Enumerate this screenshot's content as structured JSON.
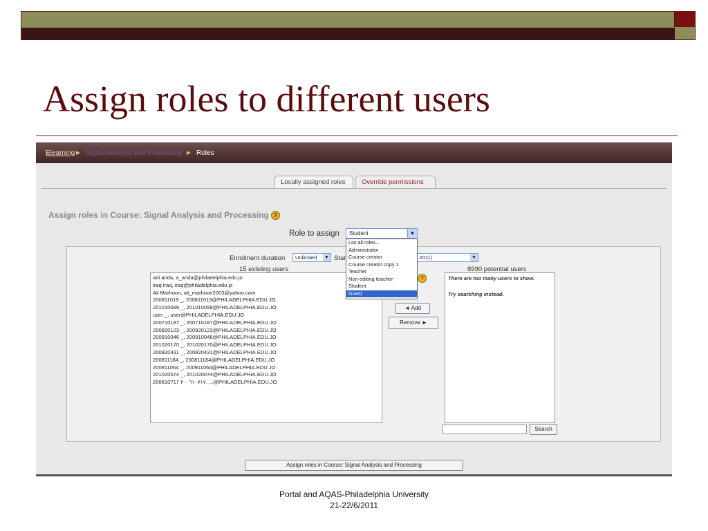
{
  "slide": {
    "title": "Assign roles to different users",
    "footer_line1": "Portal and AQAS-Philadelphia University",
    "footer_line2": "21-22/6/2011"
  },
  "breadcrumb": {
    "home": "Elearning",
    "separator": "►",
    "course": "Signal Analysis and Processing",
    "current": "Roles"
  },
  "tabs": {
    "locally_assigned": "Locally assigned roles",
    "override": "Override permissions"
  },
  "page_heading": "Assign roles in Course: Signal Analysis and Processing",
  "help_glyph": "?",
  "role": {
    "label": "Role to assign",
    "selected": "Student",
    "options": [
      "List all roles...",
      "Administrator",
      "Course creator",
      "Course creator copy 1",
      "Teacher",
      "Non-editing teacher",
      "Student",
      "Guest"
    ],
    "highlighted": "Guest"
  },
  "enrolment": {
    "duration_label": "Enrolment duration",
    "duration_value": "Unlimited",
    "start_label": "Star",
    "start_value_visible": "ne 2011)"
  },
  "existing": {
    "heading": "15 existing users",
    "users": [
      "adi arida, a_arida@philadelphia.edu.jo",
      "iraq iraq, iraq@philadelphia.edu.jo",
      "Ali Marhoon, ali_marhoon2003@yahoo.com",
      "200811019 _, 200811019@PHILADELPHIA.EDU.JO",
      "201010099 _, 201010099@PHILADELPHIA.EDU.JO",
      "user _, user@PHILADELPHIA.EDU.JO",
      "200710187 _, 200710187@PHILADELPHIA.EDU.JO",
      "200920123 _, 200920123@PHILADELPHIA.EDU.JO",
      "200910046 _, 200910046@PHILADELPHIA.EDU.JO",
      "201020170 _, 201020170@PHILADELPHIA.EDU.JO",
      "200820431 _, 200820431@PHILADELPHIA.EDU.JO",
      "200811184 _, 200811184@PHILADELPHIA.EDU.JO",
      "200911064 _, 200911064@PHILADELPHIA.EDU.JO",
      "201020074 _, 201020074@PHILADELPHIA.EDU.JO",
      "200610717 ٢٠٠٦١٠٧١٧, ...@PHILADELPHIA.EDU.JO"
    ]
  },
  "potential": {
    "heading": "8990 potential users",
    "message1": "There are too many users to show.",
    "message2": "Try searching instead."
  },
  "buttons": {
    "add": "◄ Add",
    "remove": "Remove ►",
    "search": "Search",
    "assign": "Assign roles in Course: Signal Analysis and Processing"
  }
}
